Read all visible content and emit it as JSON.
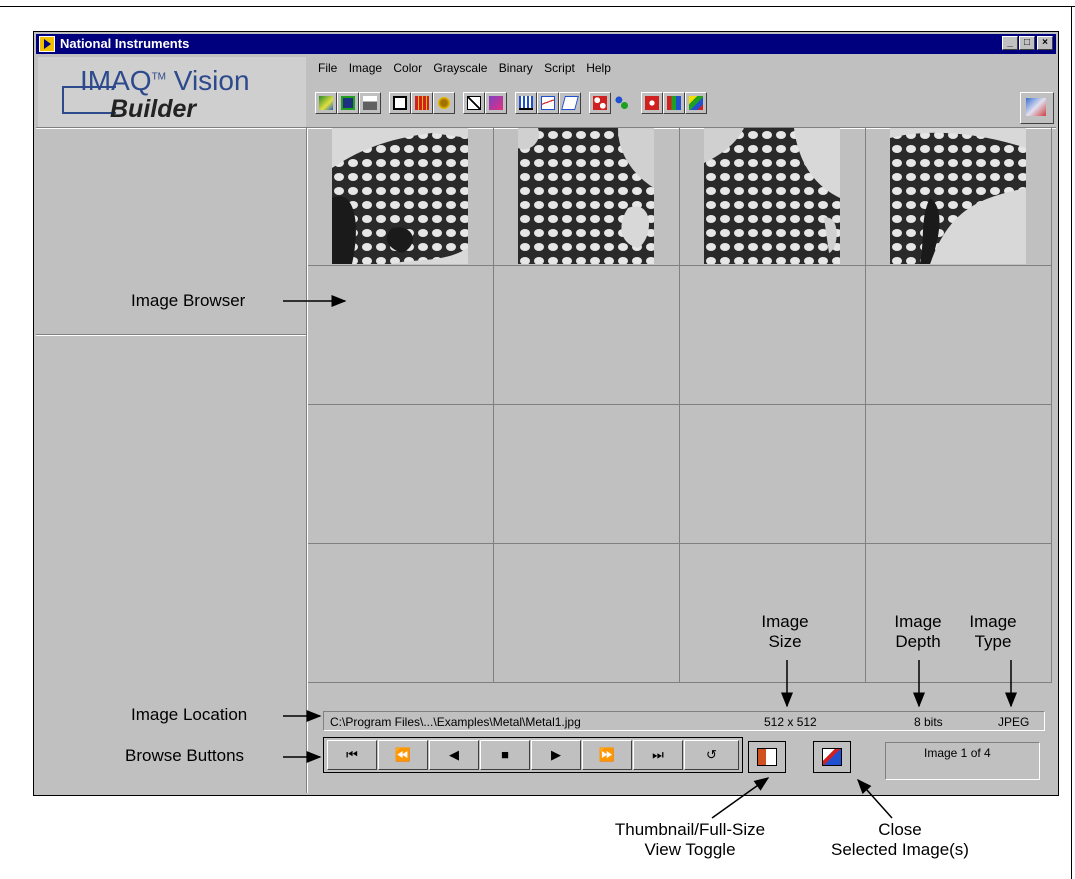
{
  "window": {
    "title": "National Instruments",
    "controls": [
      "_",
      "□",
      "×"
    ]
  },
  "logo": {
    "line1": "IMAQ",
    "tm": "TM",
    "line1b": " Vision",
    "line2": "Builder"
  },
  "menu": [
    "File",
    "Image",
    "Color",
    "Grayscale",
    "Binary",
    "Script",
    "Help"
  ],
  "toolbar_icons": [
    "acquire-image-icon",
    "save-image-icon",
    "print-icon",
    "calibration-icon",
    "color-table-icon",
    "settings-icon",
    "line-profile-icon",
    "book-icon",
    "histogram-icon",
    "line-profile-chart-icon",
    "3d-view-icon",
    "particle-analysis-icon",
    "particle-measure-icon",
    "color-threshold-icon",
    "color-plane-icon",
    "color-palette-icon",
    "image-browser-icon"
  ],
  "status": {
    "path": "C:\\Program Files\\...\\Examples\\Metal\\Metal1.jpg",
    "size": "512 x 512",
    "depth": "8 bits",
    "type": "JPEG",
    "counter": "Image  1 of 4"
  },
  "browse_buttons": [
    "⏮",
    "⏪",
    "◀",
    "■",
    "▶",
    "⏩",
    "⏭",
    "↺"
  ],
  "annotations": {
    "image_browser": "Image Browser",
    "image_location": "Image Location",
    "browse_buttons": "Browse Buttons",
    "image_size": [
      "Image",
      "Size"
    ],
    "image_depth": [
      "Image",
      "Depth"
    ],
    "image_type": [
      "Image",
      "Type"
    ],
    "thumbnail_toggle": [
      "Thumbnail/Full-Size",
      "View Toggle"
    ],
    "close_selected": [
      "Close",
      "Selected Image(s)"
    ]
  }
}
